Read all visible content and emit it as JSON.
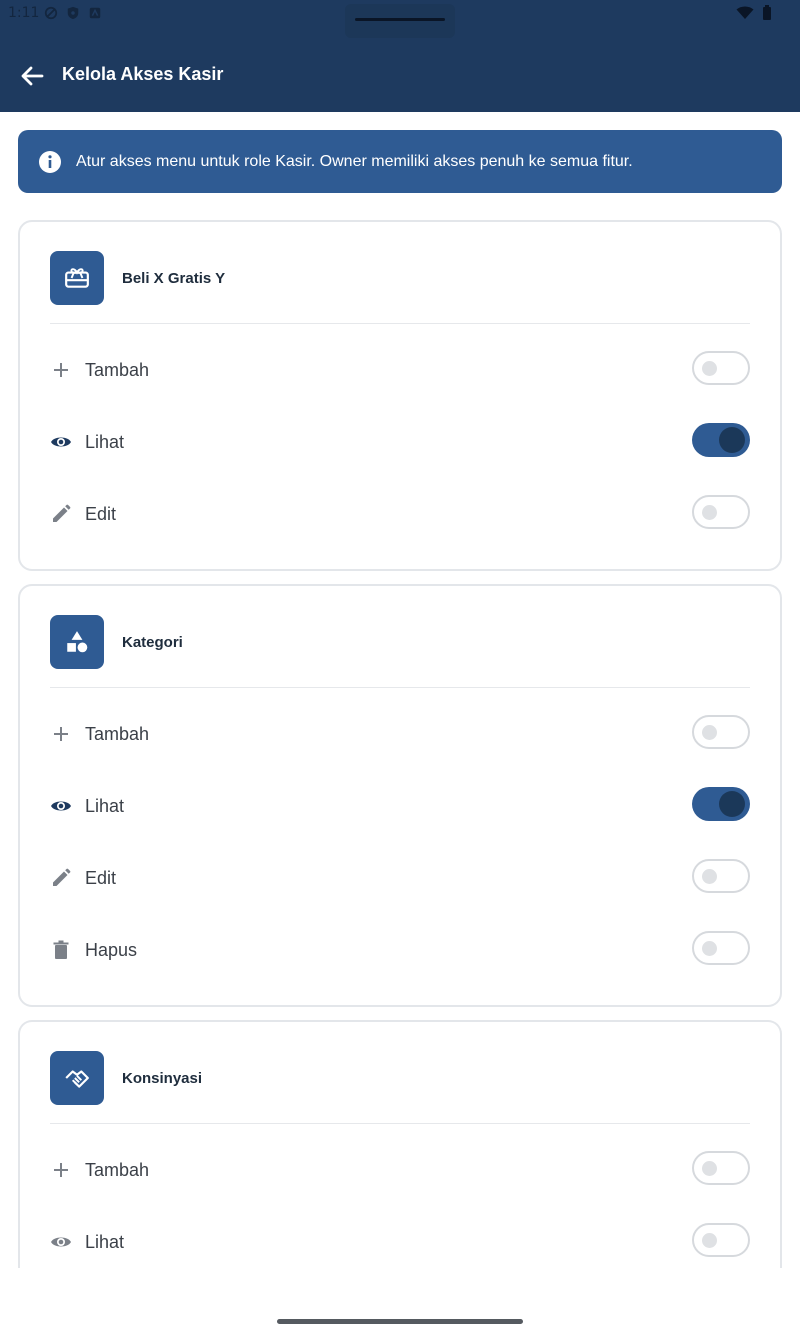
{
  "status_bar": {
    "time": "1:11"
  },
  "app_bar": {
    "title": "Kelola Akses Kasir",
    "back_icon": "arrow-left-icon"
  },
  "info_banner": {
    "icon": "info-icon",
    "text": "Atur akses menu untuk role Kasir. Owner memiliki akses penuh ke semua fitur."
  },
  "colors": {
    "primary": "#1e3a5f",
    "accent": "#2f5b93",
    "toggle_on_knob": "#1b3859"
  },
  "cards": [
    {
      "title": "Beli X Gratis Y",
      "icon": "gift-card-icon",
      "permissions": [
        {
          "label": "Tambah",
          "icon": "plus-icon",
          "enabled": false
        },
        {
          "label": "Lihat",
          "icon": "eye-icon",
          "enabled": true
        },
        {
          "label": "Edit",
          "icon": "pencil-icon",
          "enabled": false
        }
      ]
    },
    {
      "title": "Kategori",
      "icon": "shapes-icon",
      "permissions": [
        {
          "label": "Tambah",
          "icon": "plus-icon",
          "enabled": false
        },
        {
          "label": "Lihat",
          "icon": "eye-icon",
          "enabled": true
        },
        {
          "label": "Edit",
          "icon": "pencil-icon",
          "enabled": false
        },
        {
          "label": "Hapus",
          "icon": "trash-icon",
          "enabled": false
        }
      ]
    },
    {
      "title": "Konsinyasi",
      "icon": "handshake-icon",
      "permissions": [
        {
          "label": "Tambah",
          "icon": "plus-icon",
          "enabled": false
        },
        {
          "label": "Lihat",
          "icon": "eye-icon",
          "enabled": false
        }
      ]
    }
  ]
}
